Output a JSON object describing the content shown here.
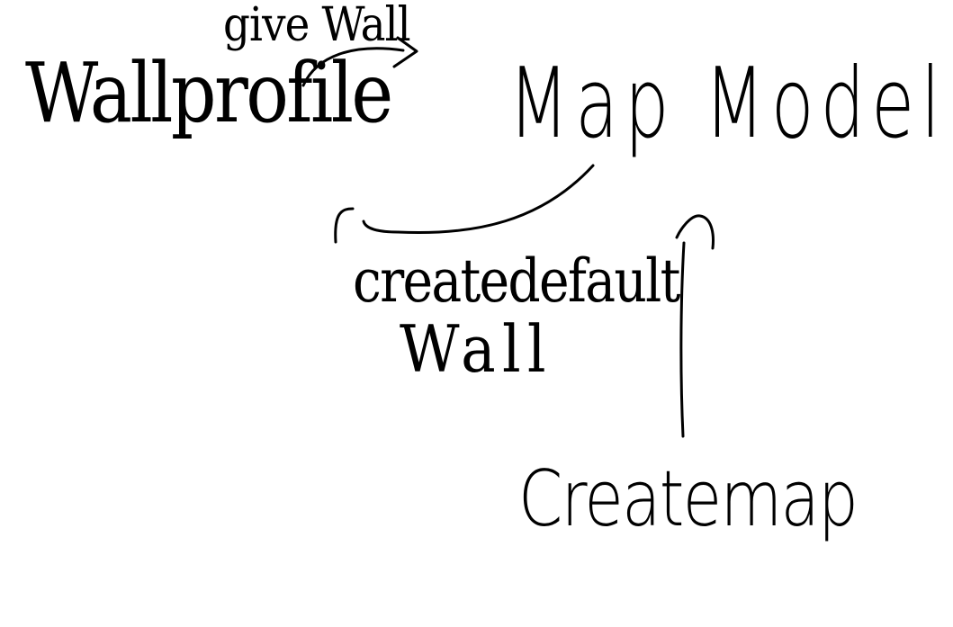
{
  "diagram": {
    "nodes": {
      "wall_profile": "Wallprofile",
      "map_model": "Map Model",
      "create_map": "Createmap"
    },
    "edges": {
      "give_wall": "give Wall",
      "create_default_wall_line1": "createdefault",
      "create_default_wall_line2": "Wall"
    },
    "colors": {
      "ink": "#000000",
      "background": "#ffffff"
    }
  }
}
